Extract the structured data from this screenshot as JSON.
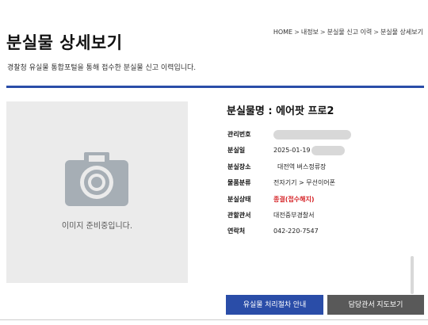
{
  "breadcrumb": {
    "items": [
      "HOME",
      "내정보",
      "분실물 신고 이력",
      "분실물 상세보기"
    ],
    "separator": ">"
  },
  "page": {
    "title": "분실물 상세보기",
    "description": "경찰청 유실물 통합포털을 통해 접수한 분실물 신고 이력입니다."
  },
  "photo": {
    "placeholder_text": "이미지 준비중입니다.",
    "icon": "camera-icon"
  },
  "item": {
    "name": "분실물명 : 에어팟 프로2",
    "fields": [
      {
        "label": "관리번호",
        "value": ""
      },
      {
        "label": "분실일",
        "value": "2025-01-19"
      },
      {
        "label": "분실장소",
        "value": "대전역 버스정류장"
      },
      {
        "label": "물품분류",
        "value": "전자기기 > 무선이어폰"
      },
      {
        "label": "분실상태",
        "value": "종결(접수해지)"
      },
      {
        "label": "관할관서",
        "value": "대전중부경찰서"
      },
      {
        "label": "연락처",
        "value": "042-220-7547"
      }
    ]
  },
  "buttons": {
    "guide": "유실물 처리절차 안내",
    "map": "담당관서 지도보기"
  },
  "colors": {
    "accent": "#2a4da8",
    "status_red": "#d6262a",
    "secondary_button": "#595959"
  }
}
